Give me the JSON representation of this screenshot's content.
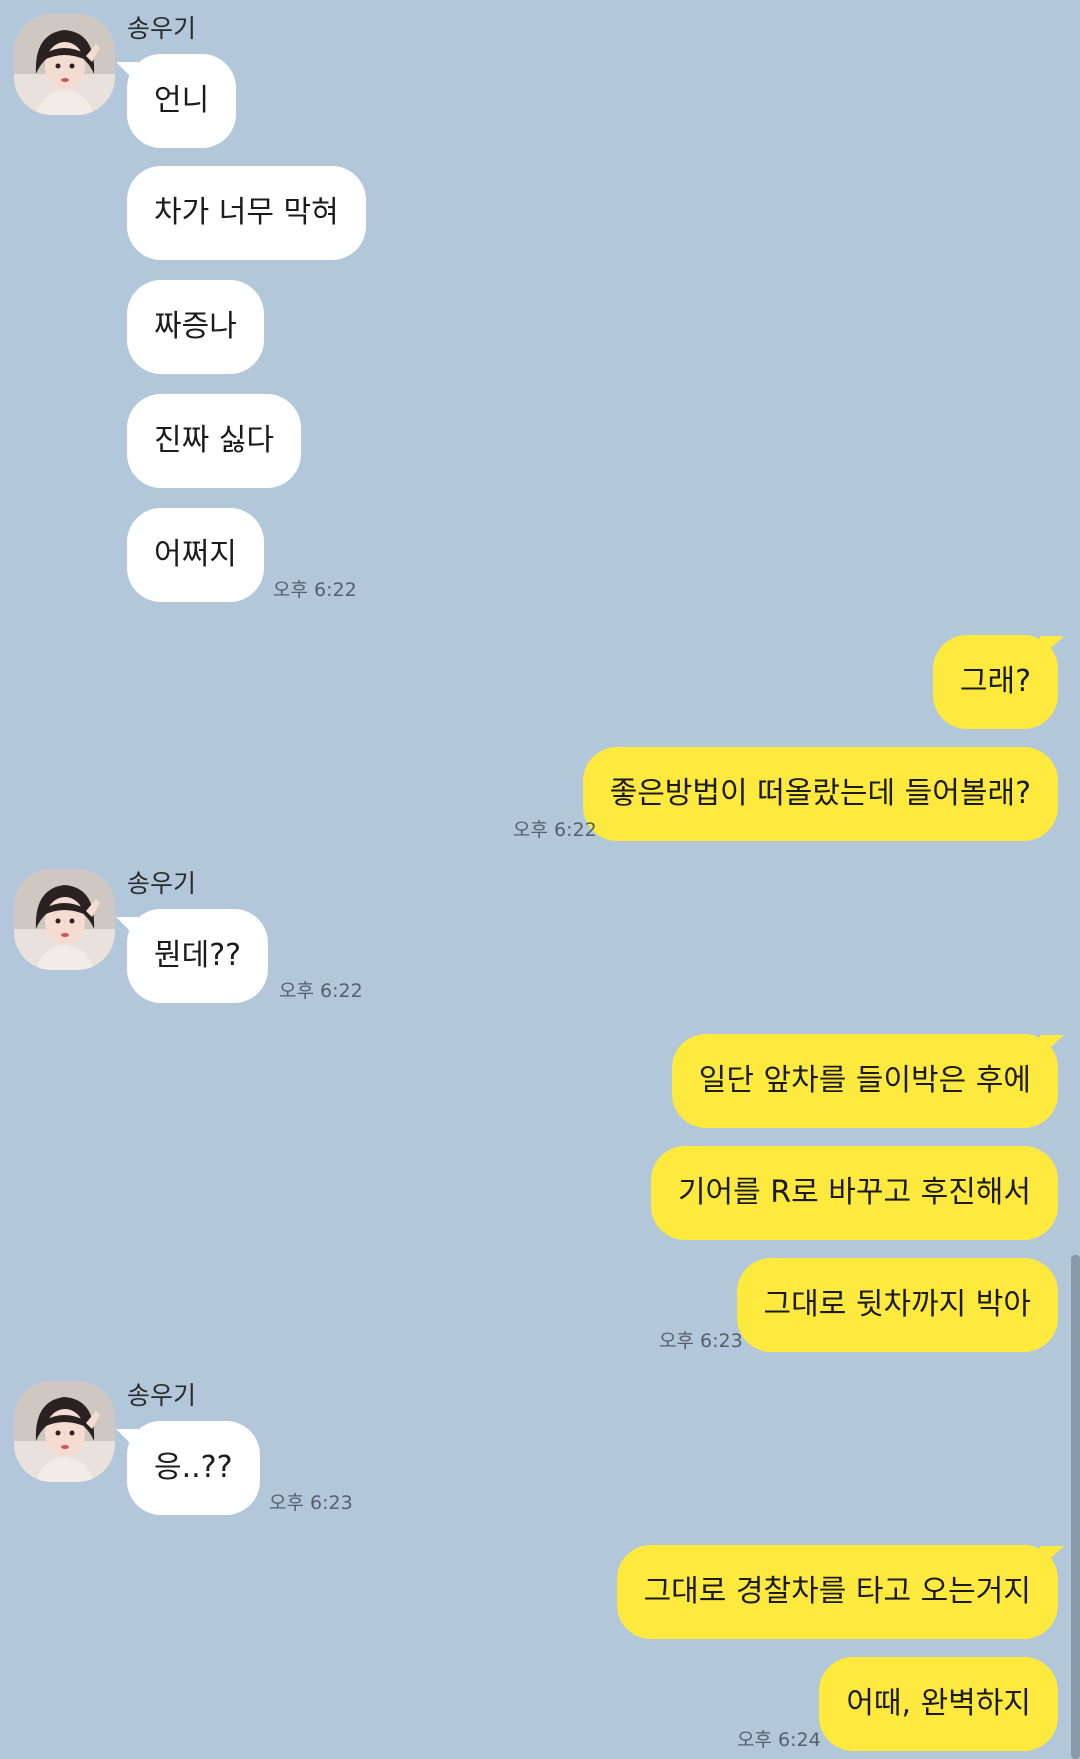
{
  "sender_name": "송우기",
  "messages": [
    {
      "text": "언니"
    },
    {
      "text": "차가 너무 막혀"
    },
    {
      "text": "짜증나"
    },
    {
      "text": "진짜 싫다"
    },
    {
      "text": "어쩌지"
    },
    {
      "text": "그래?"
    },
    {
      "text": "좋은방법이 떠올랐는데 들어볼래?"
    },
    {
      "text": "뭔데??"
    },
    {
      "text": "일단 앞차를 들이박은 후에"
    },
    {
      "text": "기어를 R로 바꾸고 후진해서"
    },
    {
      "text": "그대로 뒷차까지 박아"
    },
    {
      "text": "응..??"
    },
    {
      "text": "그대로 경찰차를 타고 오는거지"
    },
    {
      "text": "어때, 완벽하지"
    }
  ],
  "times": [
    "오후 6:22",
    "오후 6:22",
    "오후 6:22",
    "오후 6:23",
    "오후 6:23",
    "오후 6:24"
  ],
  "colors": {
    "background": "#b2c7da",
    "incoming_bubble": "#ffffff",
    "outgoing_bubble": "#fee93f"
  }
}
